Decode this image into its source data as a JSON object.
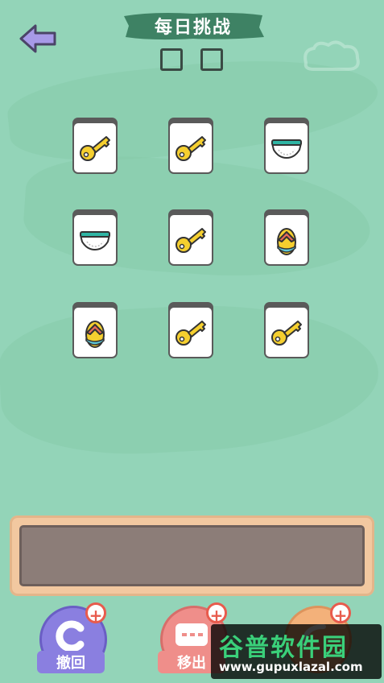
{
  "header": {
    "title": "每日挑战",
    "back_icon": "back-arrow-icon",
    "progress_slots": 2
  },
  "board": {
    "tiles": [
      {
        "icon": "key"
      },
      {
        "icon": "key"
      },
      {
        "icon": "diaper"
      },
      {
        "icon": "diaper"
      },
      {
        "icon": "key"
      },
      {
        "icon": "sandal"
      },
      {
        "icon": "sandal"
      },
      {
        "icon": "key"
      },
      {
        "icon": "key"
      }
    ]
  },
  "tray": {
    "slots": 7,
    "items": []
  },
  "tools": {
    "undo": {
      "label": "撤回",
      "color": "#8a7fe0"
    },
    "remove": {
      "label": "移出",
      "color": "#ef8e8a"
    },
    "shuffle": {
      "label": "",
      "color": "#f3b17a"
    }
  },
  "watermark": {
    "title": "谷普软件园",
    "url": "www.gupuxlazal.com"
  },
  "colors": {
    "background": "#93d4b8",
    "key": "#f5cf2f",
    "tile_edge": "#5a5a5a"
  }
}
